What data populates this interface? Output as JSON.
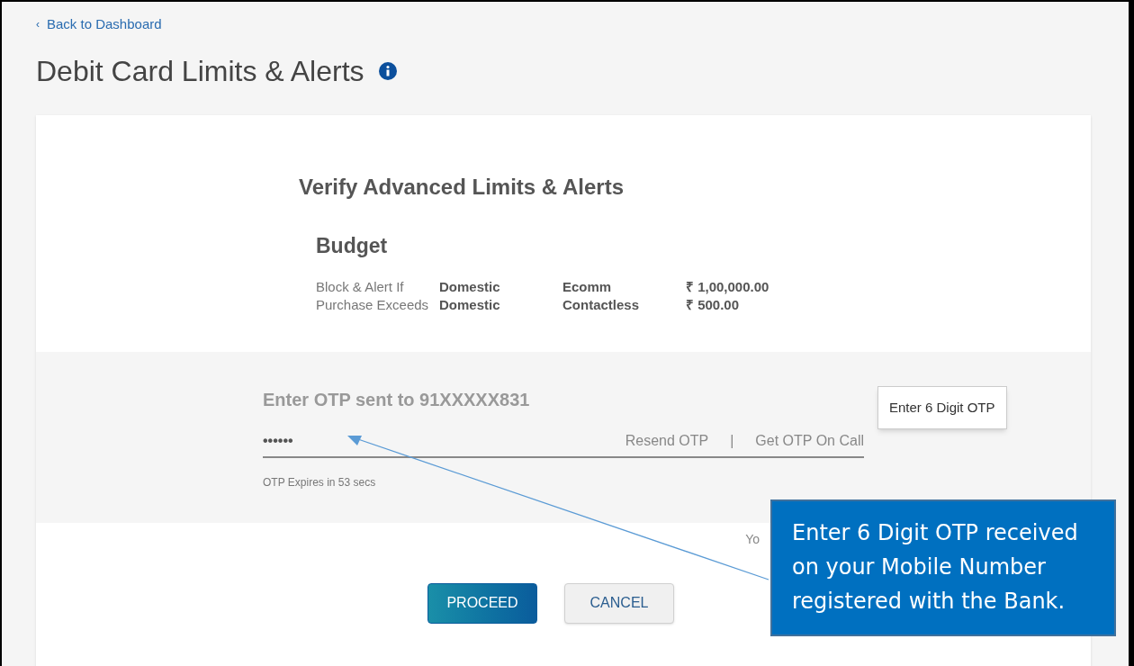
{
  "back_link": {
    "icon": "‹",
    "label": "Back to Dashboard"
  },
  "page_title": "Debit Card Limits & Alerts",
  "verify": {
    "heading": "Verify Advanced Limits & Alerts",
    "subheading": "Budget",
    "rows": [
      {
        "label": "Block & Alert If",
        "channel": "Domestic",
        "type": "Ecomm",
        "amount": "₹ 1,00,000.00"
      },
      {
        "label": "Purchase Exceeds",
        "channel": "Domestic",
        "type": "Contactless",
        "amount": "₹ 500.00"
      }
    ]
  },
  "otp": {
    "label": "Enter OTP sent to 91XXXXX831",
    "value": "••••••",
    "links": [
      "Resend OTP",
      "Get OTP On Call"
    ],
    "separator": "|",
    "expiry": "OTP Expires in 53 secs",
    "tooltip": "Enter 6 Digit OTP"
  },
  "partial_text": "Yo",
  "buttons": [
    {
      "label": "PROCEED",
      "kind": "primary"
    },
    {
      "label": "CANCEL",
      "kind": "secondary"
    }
  ],
  "callout": "Enter 6 Digit OTP received on your Mobile Number registered with the Bank."
}
